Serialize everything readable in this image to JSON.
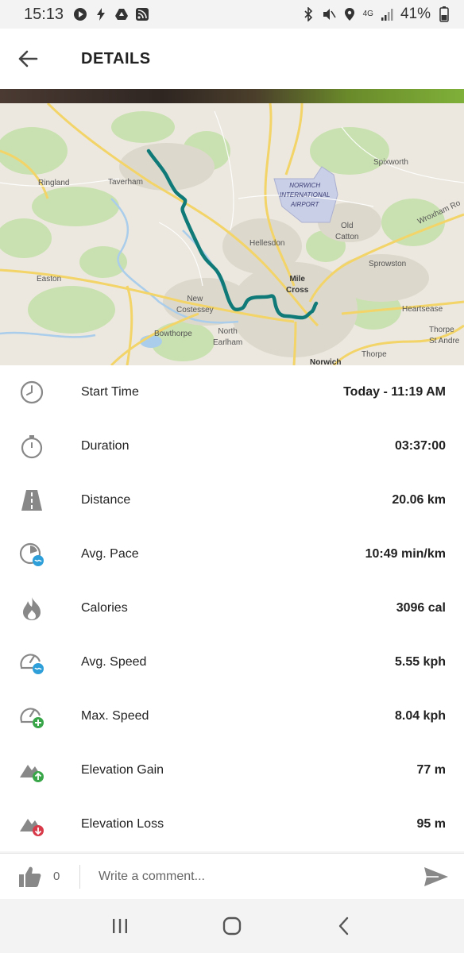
{
  "status_bar": {
    "time": "15:13",
    "network": "4G",
    "battery": "41%",
    "icons": [
      "play-icon",
      "bolt-icon",
      "drive-icon",
      "rss-icon",
      "bluetooth-icon",
      "mute-icon",
      "location-icon",
      "signal-icon",
      "battery-icon"
    ]
  },
  "header": {
    "title": "DETAILS",
    "back_icon": "arrow-left-icon"
  },
  "map": {
    "labels": {
      "spixworth": "Spixworth",
      "ringland": "Ringland",
      "taverham": "Taverham",
      "airport": "NORWICH\nINTERNATIONAL\nAIRPORT",
      "old_catton": "Old\nCatton",
      "hellesdon": "Hellesdon",
      "sprowston": "Sprowston",
      "wroxham": "Wroxham Ro",
      "easton": "Easton",
      "mile_cross": "Mile\nCross",
      "new_costessey": "New\nCostessey",
      "heartsease": "Heartsease",
      "bowthorpe": "Bowthorpe",
      "north_earlham": "North\nEarlham",
      "thorpe_st_andrew": "Thorpe\nSt Andre",
      "thorpe": "Thorpe",
      "norwich": "Norwich"
    },
    "colors": {
      "route": "#0f7a78",
      "roads": "#f2d468",
      "green": "#c9e1b0",
      "water": "#a9cdea"
    }
  },
  "stats": [
    {
      "icon": "clock-icon",
      "label": "Start Time",
      "value": "Today - 11:19 AM"
    },
    {
      "icon": "stopwatch-icon",
      "label": "Duration",
      "value": "03:37:00"
    },
    {
      "icon": "road-icon",
      "label": "Distance",
      "value": "20.06 km"
    },
    {
      "icon": "pace-icon",
      "label": "Avg. Pace",
      "value": "10:49 min/km"
    },
    {
      "icon": "flame-icon",
      "label": "Calories",
      "value": "3096 cal"
    },
    {
      "icon": "avg-speed-icon",
      "label": "Avg. Speed",
      "value": "5.55 kph"
    },
    {
      "icon": "max-speed-icon",
      "label": "Max. Speed",
      "value": "8.04 kph"
    },
    {
      "icon": "elevation-gain-icon",
      "label": "Elevation Gain",
      "value": "77 m"
    },
    {
      "icon": "elevation-loss-icon",
      "label": "Elevation Loss",
      "value": "95 m"
    }
  ],
  "comment_bar": {
    "like_count": "0",
    "placeholder": "Write a comment...",
    "like_icon": "thumbs-up-icon",
    "send_icon": "send-icon"
  },
  "nav_bar": {
    "icons": [
      "recents-icon",
      "home-icon",
      "back-icon"
    ]
  }
}
